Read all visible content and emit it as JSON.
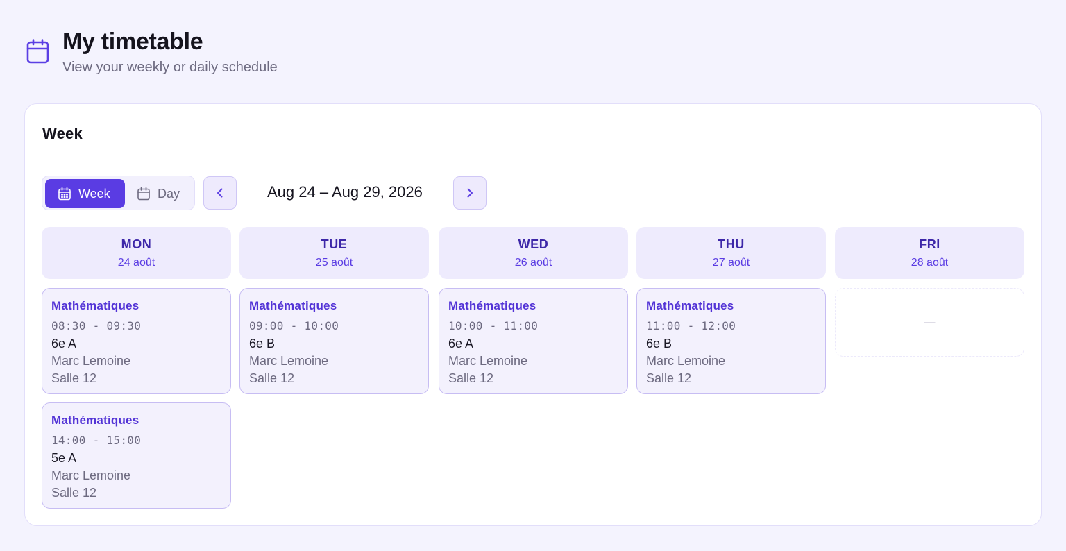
{
  "header": {
    "title": "My timetable",
    "subtitle": "View your weekly or daily schedule"
  },
  "card": {
    "title": "Week"
  },
  "toolbar": {
    "week_label": "Week",
    "day_label": "Day",
    "active_view": "week",
    "date_range": "Aug 24 – Aug 29, 2026"
  },
  "days": [
    {
      "name": "MON",
      "date": "24 août",
      "events": [
        {
          "subject": "Mathématiques",
          "time": "08:30 - 09:30",
          "class": "6e A",
          "teacher": "Marc Lemoine",
          "room": "Salle 12"
        },
        {
          "subject": "Mathématiques",
          "time": "14:00 - 15:00",
          "class": "5e A",
          "teacher": "Marc Lemoine",
          "room": "Salle 12"
        }
      ]
    },
    {
      "name": "TUE",
      "date": "25 août",
      "events": [
        {
          "subject": "Mathématiques",
          "time": "09:00 - 10:00",
          "class": "6e B",
          "teacher": "Marc Lemoine",
          "room": "Salle 12"
        }
      ]
    },
    {
      "name": "WED",
      "date": "26 août",
      "events": [
        {
          "subject": "Mathématiques",
          "time": "10:00 - 11:00",
          "class": "6e A",
          "teacher": "Marc Lemoine",
          "room": "Salle 12"
        }
      ]
    },
    {
      "name": "THU",
      "date": "27 août",
      "events": [
        {
          "subject": "Mathématiques",
          "time": "11:00 - 12:00",
          "class": "6e B",
          "teacher": "Marc Lemoine",
          "room": "Salle 12"
        }
      ]
    },
    {
      "name": "FRI",
      "date": "28 août",
      "events": [],
      "empty_label": "—"
    }
  ],
  "colors": {
    "accent": "#5a3ce3",
    "background": "#f4f3fe",
    "event_bg": "#f3f1fd",
    "day_header_bg": "#eeebfd"
  },
  "icons": {
    "header": "calendar-icon",
    "week": "calendar-grid-icon",
    "day": "calendar-icon",
    "prev": "chevron-left-icon",
    "next": "chevron-right-icon"
  }
}
